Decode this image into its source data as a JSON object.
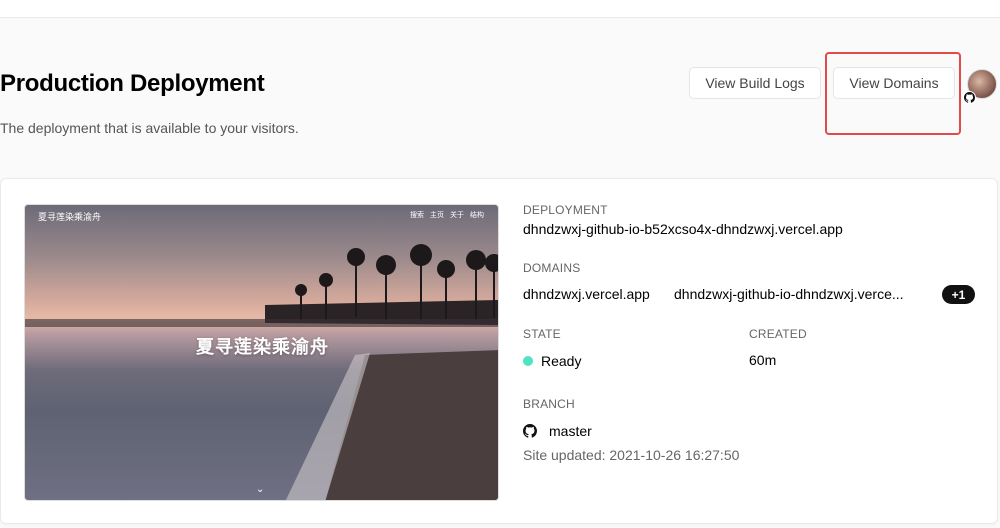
{
  "header": {
    "title": "Production Deployment",
    "subtitle": "The deployment that is available to your visitors.",
    "buttons": {
      "view_build_logs": "View Build Logs",
      "view_domains": "View Domains"
    }
  },
  "preview": {
    "site_name": "夏寻莲染乘渝舟",
    "nav": [
      "搜索",
      "主页",
      "关于",
      "结构"
    ],
    "hero_title": "夏寻莲染乘渝舟"
  },
  "details": {
    "deployment_label": "DEPLOYMENT",
    "deployment_value": "dhndzwxj-github-io-b52xcso4x-dhndzwxj.vercel.app",
    "domains_label": "DOMAINS",
    "domains": [
      "dhndzwxj.vercel.app",
      "dhndzwxj-github-io-dhndzwxj.verce..."
    ],
    "domains_extra": "+1",
    "state_label": "STATE",
    "state_value": "Ready",
    "created_label": "CREATED",
    "created_value": "60m",
    "branch_label": "BRANCH",
    "branch_value": "master",
    "site_updated": "Site updated: 2021-10-26 16:27:50"
  },
  "colors": {
    "ready": "#50e3c2",
    "highlight": "#e04a4a",
    "badge": "#111111"
  },
  "icons": {
    "github": "github-icon",
    "chevron": "chevron-down-icon"
  }
}
